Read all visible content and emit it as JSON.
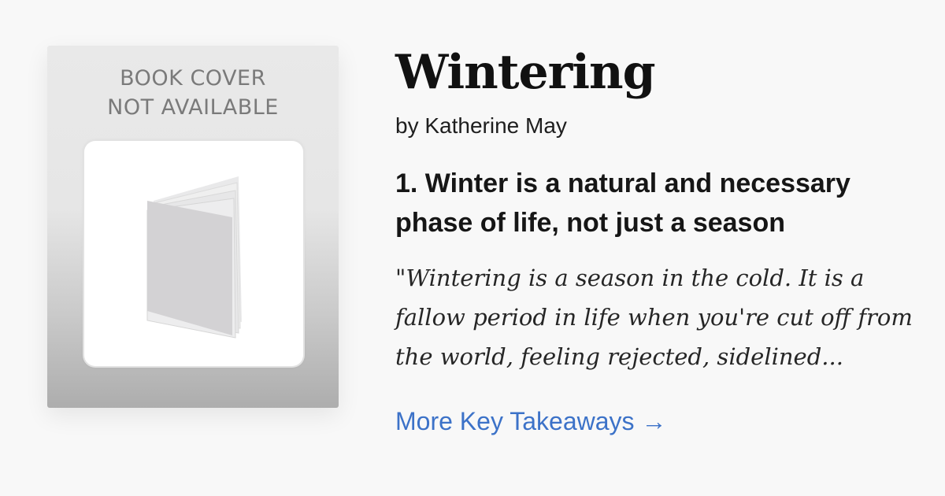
{
  "cover": {
    "line1": "BOOK COVER",
    "line2": "NOT AVAILABLE",
    "icon": "book-icon"
  },
  "book": {
    "title": "Wintering",
    "author": "by Katherine May"
  },
  "takeaway": {
    "heading": "1. Winter is a natural and necessary phase of life, not just a season",
    "quote": "\"Wintering is a season in the cold. It is a fallow period in life when you're cut off from the world, feeling rejected, sidelined..."
  },
  "link": {
    "label": "More Key Takeaways",
    "arrow": "→",
    "color": "#3c72c8"
  }
}
